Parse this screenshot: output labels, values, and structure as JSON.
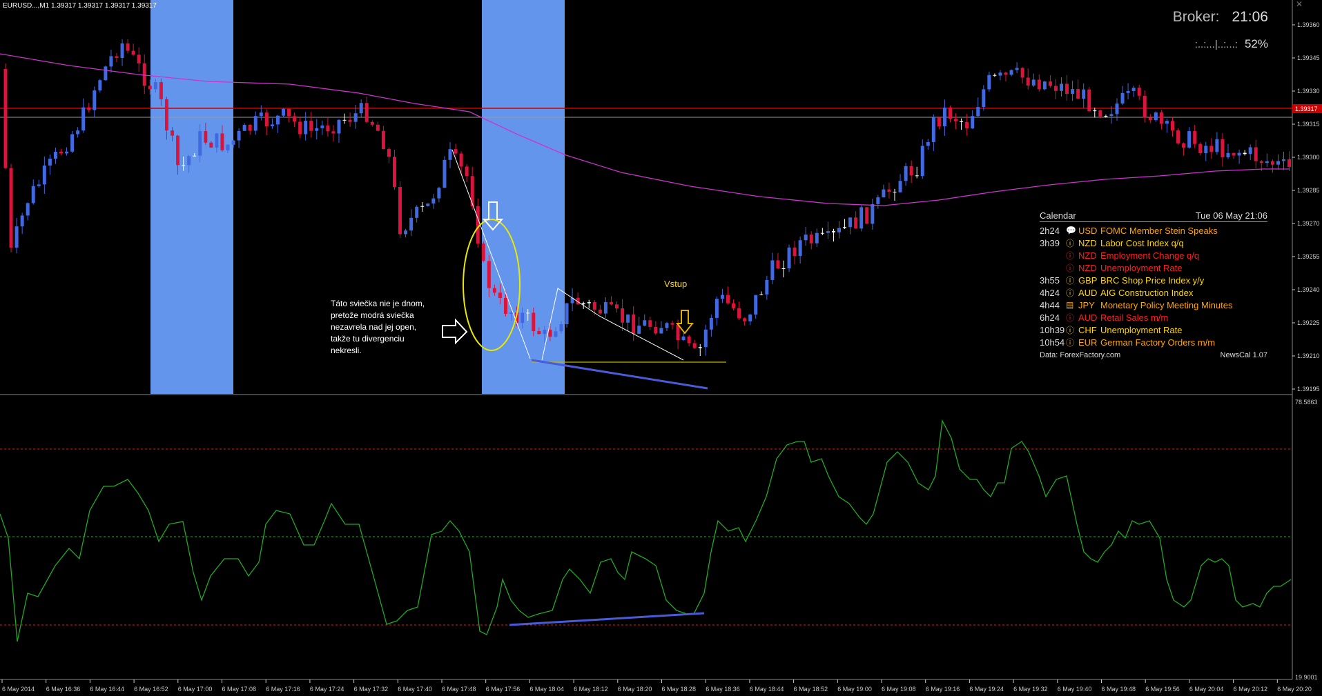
{
  "header": {
    "symbol": "EURUSD...,M1  1.39317 1.39317 1.39317 1.39317"
  },
  "broker": {
    "label": "Broker:",
    "time": "21:06",
    "progress_dots": ":..:...|..:...:",
    "progress_pct": "52%"
  },
  "price_axis": {
    "labels": [
      "1.39360",
      "1.39345",
      "1.39330",
      "1.39315",
      "1.39300",
      "1.39285",
      "1.39270",
      "1.39255",
      "1.39240",
      "1.39225",
      "1.39210",
      "1.39195"
    ],
    "current_price_tag": "1.39317"
  },
  "indicator_axis": {
    "top": "78.5863",
    "bottom": "19.9001"
  },
  "time_axis": {
    "labels": [
      "6 May 2014",
      "6 May 16:36",
      "6 May 16:44",
      "6 May 16:52",
      "6 May 17:00",
      "6 May 17:08",
      "6 May 17:16",
      "6 May 17:24",
      "6 May 17:32",
      "6 May 17:40",
      "6 May 17:48",
      "6 May 17:56",
      "6 May 18:04",
      "6 May 18:12",
      "6 May 18:20",
      "6 May 18:28",
      "6 May 18:36",
      "6 May 18:44",
      "6 May 18:52",
      "6 May 19:00",
      "6 May 19:08",
      "6 May 19:16",
      "6 May 19:24",
      "6 May 19:32",
      "6 May 19:40",
      "6 May 19:48",
      "6 May 19:56",
      "6 May 20:04",
      "6 May 20:12",
      "6 May 20:20"
    ]
  },
  "calendar": {
    "title": "Calendar",
    "date": "Tue 06 May 21:06",
    "events": [
      {
        "time": "2h24",
        "icon": "speech-icon",
        "currency": "USD",
        "name": "FOMC Member Stein Speaks",
        "color": "#ffa500"
      },
      {
        "time": "3h39",
        "icon": "info-icon",
        "currency": "NZD",
        "name": "Labor Cost Index q/q",
        "color": "#ffd700"
      },
      {
        "time": "",
        "icon": "info-icon",
        "currency": "NZD",
        "name": "Employment Change q/q",
        "color": "#ff2020"
      },
      {
        "time": "",
        "icon": "info-icon",
        "currency": "NZD",
        "name": "Unemployment Rate",
        "color": "#ff2020"
      },
      {
        "time": "3h55",
        "icon": "info-icon",
        "currency": "GBP",
        "name": "BRC Shop Price Index y/y",
        "color": "#ffd700"
      },
      {
        "time": "4h24",
        "icon": "info-icon",
        "currency": "AUD",
        "name": "AIG Construction Index",
        "color": "#ffd700"
      },
      {
        "time": "4h44",
        "icon": "document-icon",
        "currency": "JPY",
        "name": "Monetary Policy Meeting Minutes",
        "color": "#ffa500"
      },
      {
        "time": "6h24",
        "icon": "info-icon",
        "currency": "AUD",
        "name": "Retail Sales m/m",
        "color": "#ff2020"
      },
      {
        "time": "10h39",
        "icon": "info-icon",
        "currency": "CHF",
        "name": "Unemployment Rate",
        "color": "#ffd700"
      },
      {
        "time": "10h54",
        "icon": "info-icon",
        "currency": "EUR",
        "name": "German Factory Orders m/m",
        "color": "#ffa500"
      }
    ],
    "source": "Data: ForexFactory.com",
    "version": "NewsCal 1.07"
  },
  "annotations": {
    "note": "Táto sviečka nie je dnom, pretože modrá sviečka nezavrela nad jej open, takže tu divergenciu nekresli.",
    "entry": "Vstup"
  },
  "colors": {
    "bull": "#4169e1",
    "bear": "#dc143c",
    "ma": "#cc33cc",
    "session": "#6495ed",
    "oscillator": "#22aa22",
    "level_red": "#cc2222",
    "level_green": "#22aa22",
    "trendline": "#4a5bd8",
    "ellipse": "#e8e800",
    "support": "#c8b400"
  }
}
